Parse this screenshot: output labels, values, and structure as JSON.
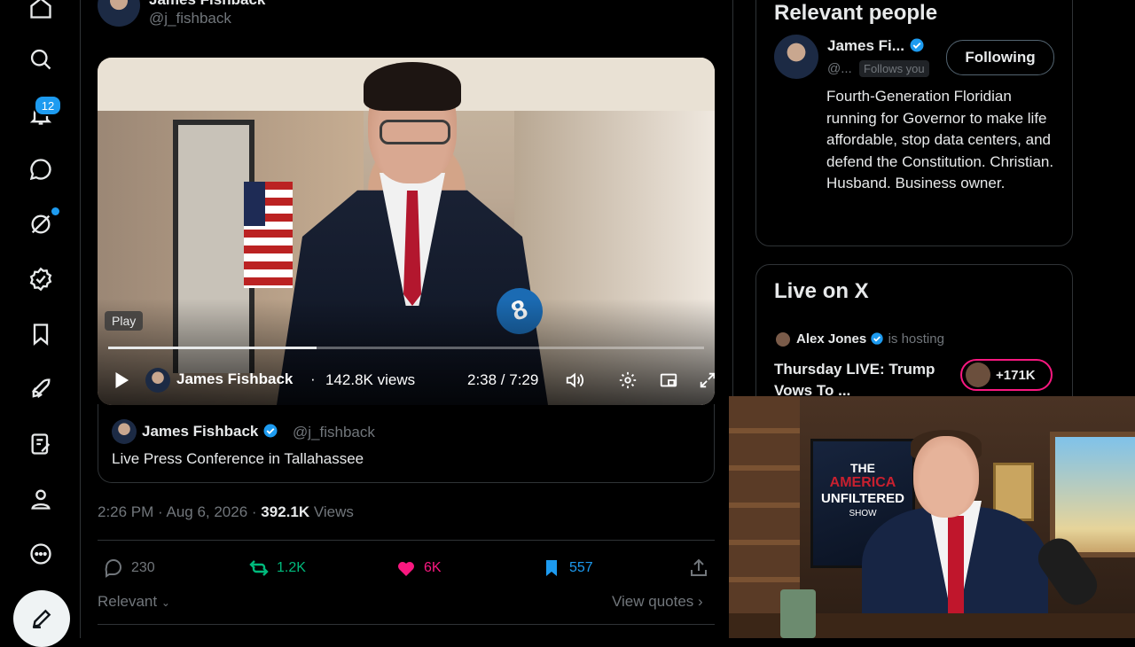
{
  "nav": {
    "notifications_badge": "12"
  },
  "tweet": {
    "author_name": "James Fishback",
    "author_handle": "@j_fishback",
    "video": {
      "tooltip": "Play",
      "channel_name": "James Fishback",
      "separator": "·",
      "views": "142.8K views",
      "time": "2:38 / 7:29",
      "progress_fraction": 0.35,
      "logo_text": "8"
    },
    "quote": {
      "name": "James Fishback",
      "handle": "@j_fishback",
      "text": "Live Press Conference in Tallahassee"
    },
    "meta": {
      "time_date": "2:26 PM · Aug 6, 2026 · ",
      "views_count": "392.1K",
      "views_label": " Views"
    },
    "actions": {
      "replies": "230",
      "reposts": "1.2K",
      "likes": "6K",
      "bookmarks": "557"
    },
    "relevant_label": "Relevant",
    "view_quotes_label": "View quotes"
  },
  "relevant_people": {
    "title": "Relevant people",
    "name": "James Fi...",
    "handle": "@...",
    "follows_you": "Follows you",
    "follow_button": "Following",
    "bio": "Fourth-Generation Floridian running for Governor to make life affordable, stop data centers, and defend the Constitution. Christian. Husband. Business owner."
  },
  "live": {
    "title": "Live on X",
    "host_name": "Alex Jones",
    "host_status": " is hosting",
    "broadcast_title": "Thursday LIVE: Trump Vows To ...",
    "listener_count": "+171K"
  },
  "overlay": {
    "show_line1": "THE",
    "show_line2": "AMERICA",
    "show_line3": "UNFILTERED",
    "show_line4": "SHOW"
  },
  "colors": {
    "accent": "#1d9bf0",
    "repost": "#00ba7c",
    "like": "#f91880",
    "muted": "#71767b",
    "border": "#2f3336"
  }
}
